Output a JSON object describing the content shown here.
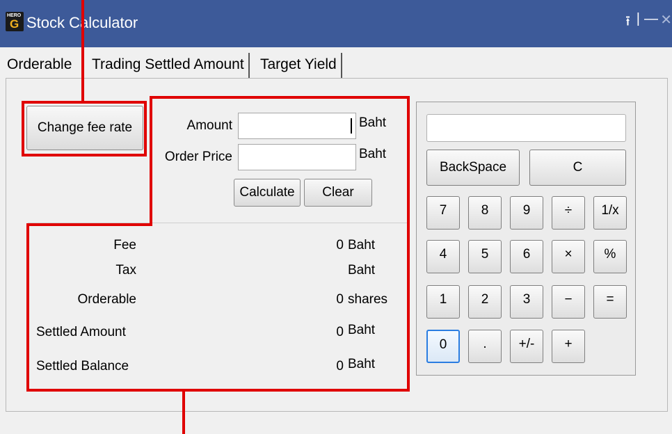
{
  "window": {
    "title": "Stock Calculator",
    "icon_small_text": "HERO",
    "icon_letter": "G"
  },
  "title_controls": {
    "pin": "⭱",
    "sep": "|",
    "minimize": "—",
    "close": "✕"
  },
  "tabs": [
    {
      "label": "Orderable"
    },
    {
      "label": "Trading Settled Amount"
    },
    {
      "label": "Target Yield"
    }
  ],
  "fee": {
    "change_button": "Change fee rate"
  },
  "form": {
    "amount_label": "Amount",
    "amount_value": "",
    "amount_unit": "Baht",
    "price_label": "Order Price",
    "price_value": "",
    "price_unit": "Baht",
    "calculate": "Calculate",
    "clear": "Clear"
  },
  "results": [
    {
      "label": "Fee",
      "value": "0",
      "unit": "Baht"
    },
    {
      "label": "Tax",
      "value": "",
      "unit": "Baht"
    },
    {
      "label": "Orderable",
      "value": "0",
      "unit": "shares"
    },
    {
      "label": "Settled Amount",
      "value": "0",
      "unit": "Baht"
    },
    {
      "label": "Settled Balance",
      "value": "0",
      "unit": "Baht"
    }
  ],
  "calculator": {
    "display": "",
    "backspace": "BackSpace",
    "clear": "C",
    "keys": [
      "7",
      "8",
      "9",
      "÷",
      "1/x",
      "4",
      "5",
      "6",
      "×",
      "%",
      "1",
      "2",
      "3",
      "−",
      "=",
      "0",
      ".",
      "+/-",
      "+"
    ]
  },
  "colors": {
    "titlebar": "#3d5a99",
    "annotation": "#e00000",
    "focus": "#2a7de1"
  }
}
